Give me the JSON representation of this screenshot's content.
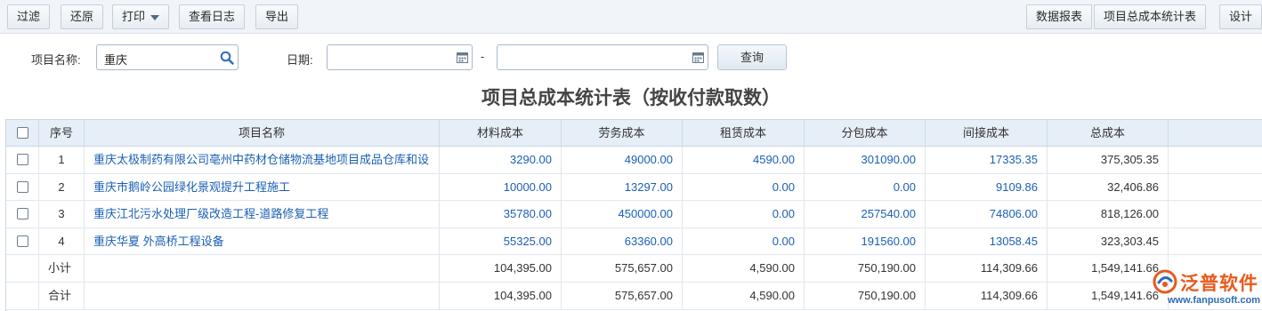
{
  "toolbar": {
    "filter": "过滤",
    "restore": "还原",
    "print": "打印",
    "view_log": "查看日志",
    "export": "导出",
    "data_report": "数据报表",
    "report_name": "项目总成本统计表",
    "design": "设计"
  },
  "search": {
    "project_label": "项目名称:",
    "project_value": "重庆",
    "date_label": "日期:",
    "date_sep": "-",
    "query": "查询"
  },
  "report_title": "项目总成本统计表（按收付款取数）",
  "table": {
    "headers": [
      "序号",
      "项目名称",
      "材料成本",
      "劳务成本",
      "租赁成本",
      "分包成本",
      "间接成本",
      "总成本"
    ],
    "rows": [
      {
        "no": "1",
        "name": "重庆太极制药有限公司亳州中药材仓储物流基地项目成品仓库和设",
        "material": "3290.00",
        "labor": "49000.00",
        "lease": "4590.00",
        "sub": "301090.00",
        "indirect": "17335.35",
        "total": "375,305.35"
      },
      {
        "no": "2",
        "name": "重庆市鹅岭公园绿化景观提升工程施工",
        "material": "10000.00",
        "labor": "13297.00",
        "lease": "0.00",
        "sub": "0.00",
        "indirect": "9109.86",
        "total": "32,406.86"
      },
      {
        "no": "3",
        "name": "重庆江北污水处理厂级改造工程-道路修复工程",
        "material": "35780.00",
        "labor": "450000.00",
        "lease": "0.00",
        "sub": "257540.00",
        "indirect": "74806.00",
        "total": "818,126.00"
      },
      {
        "no": "4",
        "name": "重庆华夏 外高桥工程设备",
        "material": "55325.00",
        "labor": "63360.00",
        "lease": "0.00",
        "sub": "191560.00",
        "indirect": "13058.45",
        "total": "323,303.45"
      }
    ],
    "subtotal": {
      "label": "小计",
      "material": "104,395.00",
      "labor": "575,657.00",
      "lease": "4,590.00",
      "sub": "750,190.00",
      "indirect": "114,309.66",
      "total": "1,549,141.66"
    },
    "grandtotal": {
      "label": "合计",
      "material": "104,395.00",
      "labor": "575,657.00",
      "lease": "4,590.00",
      "sub": "750,190.00",
      "indirect": "114,309.66",
      "total": "1,549,141.66"
    }
  },
  "logo": {
    "brand": "泛普软件",
    "url": "www.fanpusoft.com"
  },
  "colors": {
    "link": "#1a5fb4",
    "header_bg": "#e6eef7",
    "brand": "#e85a1c"
  }
}
